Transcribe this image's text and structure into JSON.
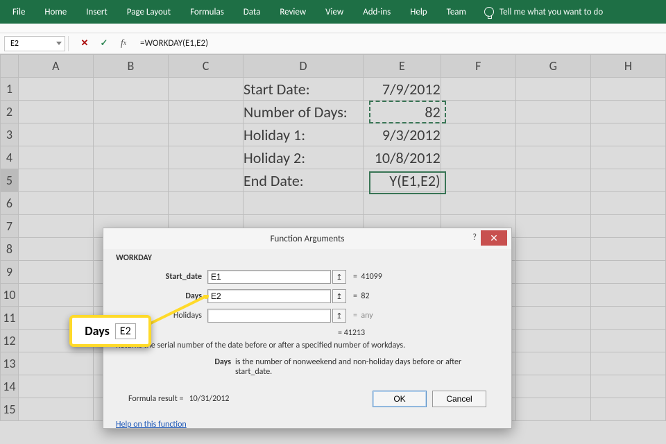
{
  "ribbon": {
    "items": [
      "File",
      "Home",
      "Insert",
      "Page Layout",
      "Formulas",
      "Data",
      "Review",
      "View",
      "Add-ins",
      "Help",
      "Team"
    ],
    "tellme": "Tell me what you want to do"
  },
  "namebox": "E2",
  "formula": "=WORKDAY(E1,E2)",
  "columns": [
    "A",
    "B",
    "C",
    "D",
    "E",
    "F",
    "G",
    "H"
  ],
  "rows_shown": 15,
  "selected_row_header": 5,
  "cells": {
    "D1": "Start Date:",
    "E1": "7/9/2012",
    "D2": "Number of Days:",
    "E2": "82",
    "D3": "Holiday 1:",
    "E3": "9/3/2012",
    "D4": "Holiday 2:",
    "E4": "10/8/2012",
    "D5": "End Date:",
    "E5": " Y(E1,E2)"
  },
  "dialog": {
    "title": "Function Arguments",
    "func": "WORKDAY",
    "args": [
      {
        "label": "Start_date",
        "bold": true,
        "value": "E1",
        "result": "41099"
      },
      {
        "label": "Days",
        "bold": true,
        "value": "E2",
        "result": "82"
      },
      {
        "label": "Holidays",
        "bold": false,
        "value": "",
        "result": "any",
        "any": true
      }
    ],
    "calc_equals": "=  41213",
    "desc1": "Returns the serial number of the date before or after a specified number of workdays.",
    "desc2_label": "Days",
    "desc2_text": "is the number of nonweekend and non-holiday days before or after start_date.",
    "formula_result_label": "Formula result =",
    "formula_result": "10/31/2012",
    "help": "Help on this function",
    "ok": "OK",
    "cancel": "Cancel"
  },
  "callout": {
    "label": "Days",
    "value": "E2"
  }
}
